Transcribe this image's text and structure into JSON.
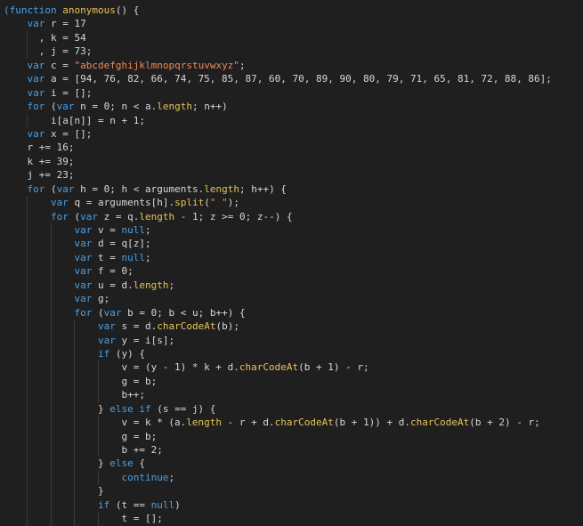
{
  "editor": {
    "lines": [
      [
        [
          "kw",
          "(function "
        ],
        [
          "fn",
          "anonymous"
        ],
        [
          "pl",
          "() {"
        ]
      ],
      [
        [
          "ws",
          "    "
        ],
        [
          "kw",
          "var "
        ],
        [
          "pl",
          "r = 17"
        ]
      ],
      [
        [
          "ws",
          "      "
        ],
        [
          "pl",
          ", k = 54"
        ]
      ],
      [
        [
          "ws",
          "      "
        ],
        [
          "pl",
          ", j = 73;"
        ]
      ],
      [
        [
          "ws",
          "    "
        ],
        [
          "kw",
          "var "
        ],
        [
          "pl",
          "c = "
        ],
        [
          "str",
          "\"abcdefghijklmnopqrstuvwxyz\""
        ],
        [
          "pl",
          ";"
        ]
      ],
      [
        [
          "ws",
          "    "
        ],
        [
          "kw",
          "var "
        ],
        [
          "pl",
          "a = [94, 76, 82, 66, 74, 75, 85, 87, 60, 70, 89, 90, 80, 79, 71, 65, 81, 72, 88, 86];"
        ]
      ],
      [
        [
          "ws",
          "    "
        ],
        [
          "kw",
          "var "
        ],
        [
          "pl",
          "i = [];"
        ]
      ],
      [
        [
          "ws",
          "    "
        ],
        [
          "kw",
          "for "
        ],
        [
          "pl",
          "("
        ],
        [
          "kw",
          "var "
        ],
        [
          "pl",
          "n = 0; n < a."
        ],
        [
          "prop",
          "length"
        ],
        [
          "pl",
          "; n++)"
        ]
      ],
      [
        [
          "ws",
          "        "
        ],
        [
          "pl",
          "i[a[n]] = n + 1;"
        ]
      ],
      [
        [
          "ws",
          "    "
        ],
        [
          "kw",
          "var "
        ],
        [
          "pl",
          "x = [];"
        ]
      ],
      [
        [
          "ws",
          "    "
        ],
        [
          "pl",
          "r += 16;"
        ]
      ],
      [
        [
          "ws",
          "    "
        ],
        [
          "pl",
          "k += 39;"
        ]
      ],
      [
        [
          "ws",
          "    "
        ],
        [
          "pl",
          "j += 23;"
        ]
      ],
      [
        [
          "ws",
          "    "
        ],
        [
          "kw",
          "for "
        ],
        [
          "pl",
          "("
        ],
        [
          "kw",
          "var "
        ],
        [
          "pl",
          "h = 0; h < arguments."
        ],
        [
          "prop",
          "length"
        ],
        [
          "pl",
          "; h++) {"
        ]
      ],
      [
        [
          "ws",
          "        "
        ],
        [
          "kw",
          "var "
        ],
        [
          "pl",
          "q = arguments[h]."
        ],
        [
          "fn",
          "split"
        ],
        [
          "pl",
          "("
        ],
        [
          "str",
          "\" \""
        ],
        [
          "pl",
          ");"
        ]
      ],
      [
        [
          "ws",
          "        "
        ],
        [
          "kw",
          "for "
        ],
        [
          "pl",
          "("
        ],
        [
          "kw",
          "var "
        ],
        [
          "pl",
          "z = q."
        ],
        [
          "prop",
          "length"
        ],
        [
          "pl",
          " - 1; z >= 0; z--) {"
        ]
      ],
      [
        [
          "ws",
          "            "
        ],
        [
          "kw",
          "var "
        ],
        [
          "pl",
          "v = "
        ],
        [
          "kw",
          "null"
        ],
        [
          "pl",
          ";"
        ]
      ],
      [
        [
          "ws",
          "            "
        ],
        [
          "kw",
          "var "
        ],
        [
          "pl",
          "d = q[z];"
        ]
      ],
      [
        [
          "ws",
          "            "
        ],
        [
          "kw",
          "var "
        ],
        [
          "pl",
          "t = "
        ],
        [
          "kw",
          "null"
        ],
        [
          "pl",
          ";"
        ]
      ],
      [
        [
          "ws",
          "            "
        ],
        [
          "kw",
          "var "
        ],
        [
          "pl",
          "f = 0;"
        ]
      ],
      [
        [
          "ws",
          "            "
        ],
        [
          "kw",
          "var "
        ],
        [
          "pl",
          "u = d."
        ],
        [
          "prop",
          "length"
        ],
        [
          "pl",
          ";"
        ]
      ],
      [
        [
          "ws",
          "            "
        ],
        [
          "kw",
          "var "
        ],
        [
          "pl",
          "g;"
        ]
      ],
      [
        [
          "ws",
          "            "
        ],
        [
          "kw",
          "for "
        ],
        [
          "pl",
          "("
        ],
        [
          "kw",
          "var "
        ],
        [
          "pl",
          "b = 0; b < u; b++) {"
        ]
      ],
      [
        [
          "ws",
          "                "
        ],
        [
          "kw",
          "var "
        ],
        [
          "pl",
          "s = d."
        ],
        [
          "fn",
          "charCodeAt"
        ],
        [
          "pl",
          "(b);"
        ]
      ],
      [
        [
          "ws",
          "                "
        ],
        [
          "kw",
          "var "
        ],
        [
          "pl",
          "y = i[s];"
        ]
      ],
      [
        [
          "ws",
          "                "
        ],
        [
          "kw",
          "if "
        ],
        [
          "pl",
          "(y) {"
        ]
      ],
      [
        [
          "ws",
          "                    "
        ],
        [
          "pl",
          "v = (y - 1) * k + d."
        ],
        [
          "fn",
          "charCodeAt"
        ],
        [
          "pl",
          "(b + 1) - r;"
        ]
      ],
      [
        [
          "ws",
          "                    "
        ],
        [
          "pl",
          "g = b;"
        ]
      ],
      [
        [
          "ws",
          "                    "
        ],
        [
          "pl",
          "b++;"
        ]
      ],
      [
        [
          "ws",
          "                "
        ],
        [
          "pl",
          "} "
        ],
        [
          "kw",
          "else if "
        ],
        [
          "pl",
          "(s == j) {"
        ]
      ],
      [
        [
          "ws",
          "                    "
        ],
        [
          "pl",
          "v = k * (a."
        ],
        [
          "prop",
          "length"
        ],
        [
          "pl",
          " - r + d."
        ],
        [
          "fn",
          "charCodeAt"
        ],
        [
          "pl",
          "(b + 1)) + d."
        ],
        [
          "fn",
          "charCodeAt"
        ],
        [
          "pl",
          "(b + 2) - r;"
        ]
      ],
      [
        [
          "ws",
          "                    "
        ],
        [
          "pl",
          "g = b;"
        ]
      ],
      [
        [
          "ws",
          "                    "
        ],
        [
          "pl",
          "b += 2;"
        ]
      ],
      [
        [
          "ws",
          "                "
        ],
        [
          "pl",
          "} "
        ],
        [
          "kw",
          "else "
        ],
        [
          "pl",
          "{"
        ]
      ],
      [
        [
          "ws",
          "                    "
        ],
        [
          "kw",
          "continue"
        ],
        [
          "pl",
          ";"
        ]
      ],
      [
        [
          "ws",
          "                "
        ],
        [
          "pl",
          "}"
        ]
      ],
      [
        [
          "ws",
          "                "
        ],
        [
          "kw",
          "if "
        ],
        [
          "pl",
          "(t == "
        ],
        [
          "kw",
          "null"
        ],
        [
          "pl",
          ")"
        ]
      ],
      [
        [
          "ws",
          "                    "
        ],
        [
          "pl",
          "t = [];"
        ]
      ]
    ]
  }
}
